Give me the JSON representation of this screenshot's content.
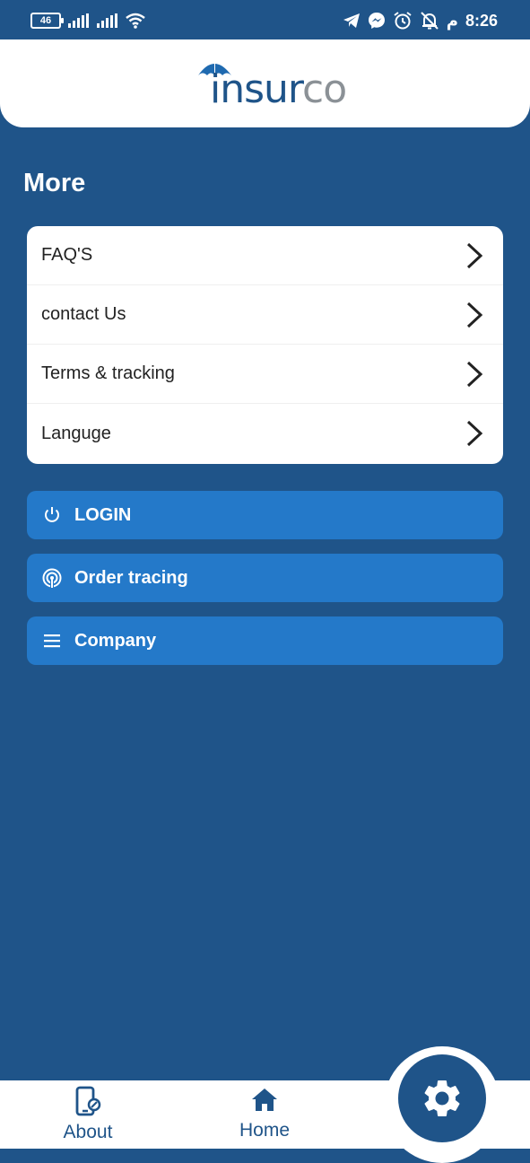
{
  "status_bar": {
    "battery": "46",
    "time": "8:26",
    "ampm": "م",
    "icons": [
      "signal-icon",
      "signal-icon",
      "wifi-icon",
      "telegram-icon",
      "messenger-icon",
      "alarm-icon",
      "notifications-off-icon"
    ]
  },
  "header": {
    "logo_part1": "insur",
    "logo_part2": "co"
  },
  "page": {
    "title": "More"
  },
  "menu": {
    "items": [
      {
        "label": "FAQ'S"
      },
      {
        "label": "contact Us"
      },
      {
        "label": "Terms & tracking"
      },
      {
        "label": "Languge"
      }
    ]
  },
  "actions": {
    "login": "LOGIN",
    "order_tracing": "Order tracing",
    "company": "Company"
  },
  "bottom_nav": {
    "about": "About",
    "home": "Home"
  },
  "colors": {
    "background": "#1f5489",
    "button": "#2479c9",
    "logo_blue": "#1f5489",
    "logo_gray": "#8b9196"
  }
}
